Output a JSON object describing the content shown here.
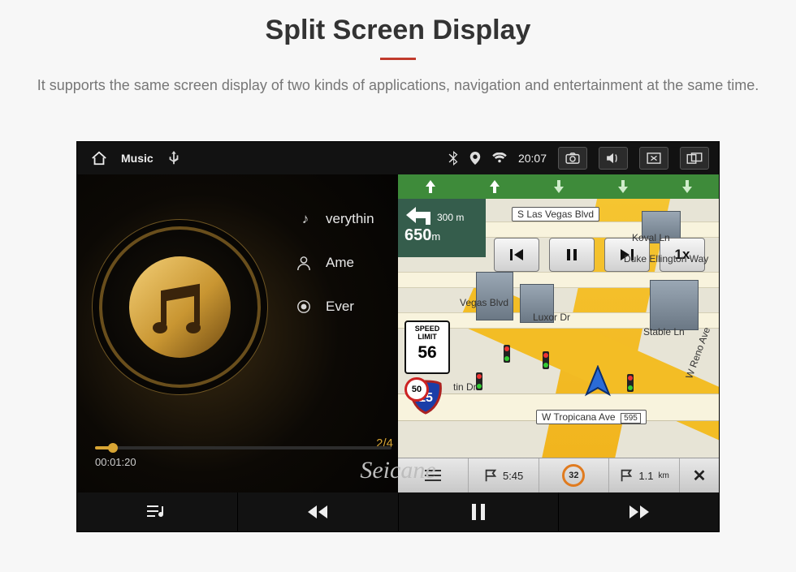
{
  "header": {
    "title": "Split Screen Display",
    "description": "It supports the same screen display of two kinds of applications, navigation and entertainment at the same time."
  },
  "status_bar": {
    "app_title": "Music",
    "time": "20:07",
    "icons": [
      "bluetooth-icon",
      "location-icon",
      "wifi-icon"
    ],
    "right_buttons": [
      "camera-icon",
      "volume-icon",
      "close-panel-icon",
      "split-view-icon"
    ]
  },
  "music": {
    "tracks": [
      {
        "icon": "note-icon",
        "label": "verythin"
      },
      {
        "icon": "person-icon",
        "label": "Ame"
      },
      {
        "icon": "target-icon",
        "label": "Ever"
      }
    ],
    "counter": "2/4",
    "elapsed": "00:01:20",
    "remaining": ""
  },
  "playbar": {
    "buttons": [
      "playlist-icon",
      "prev-track-icon",
      "pause-icon",
      "next-track-icon"
    ]
  },
  "nav": {
    "top_arrow_count": 5,
    "turn": {
      "next_m": "300 m",
      "dist": "650",
      "unit": "m"
    },
    "controls": [
      "prev",
      "pause",
      "next",
      "1x"
    ],
    "speed": {
      "label": "SPEED LIMIT",
      "value": "56"
    },
    "shield": {
      "route": "15",
      "current_speed": "50"
    },
    "streets": {
      "top": "S Las Vegas Blvd",
      "koval": "Koval Ln",
      "duke": "Duke Ellington Way",
      "luxor": "Luxor Dr",
      "stable": "Stable Ln",
      "reno": "W Reno Ave",
      "vegas": "Vegas Blvd",
      "tin": "tin Dr",
      "tropicana": "W Tropicana Ave",
      "tropicana_num": "595"
    },
    "bottom": {
      "eta": "5:45",
      "speed_badge": "32",
      "dist": "1.1",
      "dist_unit": "km"
    }
  },
  "watermark": "Seicane"
}
